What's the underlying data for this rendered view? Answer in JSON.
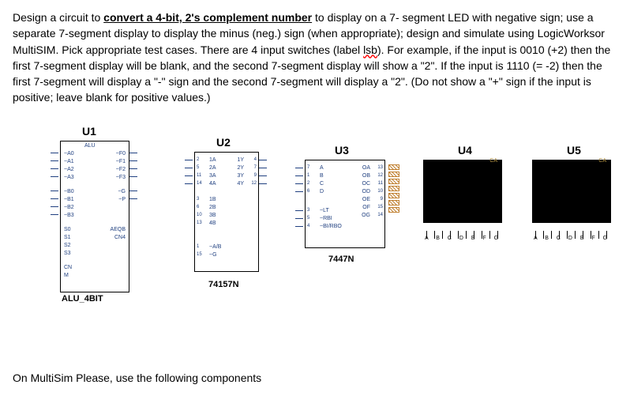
{
  "problem": {
    "lead_in": "Design a circuit to ",
    "underlined": "convert a 4-bit, 2's complement number",
    "rest1": " to display on a 7- segment LED with negative sign; use a separate 7-segment display to display the minus (neg.) sign (when appropriate); design and simulate using LogicWorksor MultiSIM. Pick appropriate test cases. There are 4 input switches (label ",
    "lsb": "lsb",
    "rest2": "). For example, if the input is 0010 (+2) then the first 7-segment display will be blank, and the second 7-segment display will show a \"2\". If the input is 1110 (= -2) then the first 7-segment will display a \"-\" sign and the second 7-segment will display a \"2\". (Do not show a \"+\" sign if the input is positive; leave blank for positive values.)"
  },
  "u1": {
    "ref": "U1",
    "block": "ALU",
    "name": "ALU_4BIT",
    "left_pins": [
      "~A0",
      "~A1",
      "~A2",
      "~A3",
      "~B0",
      "~B1",
      "~B2",
      "~B3",
      "S0",
      "S1",
      "S2",
      "S3",
      "CN",
      "M"
    ],
    "right_pins": [
      "~F0",
      "~F1",
      "~F2",
      "~F3",
      "~G",
      "~P",
      "AEQB",
      "CN4"
    ]
  },
  "u2": {
    "ref": "U2",
    "name": "74157N",
    "left_a": [
      "1A",
      "2A",
      "3A",
      "4A"
    ],
    "left_a_nums": [
      "2",
      "5",
      "11",
      "14"
    ],
    "left_b": [
      "1B",
      "2B",
      "3B",
      "4B"
    ],
    "left_b_nums": [
      "3",
      "6",
      "10",
      "13"
    ],
    "left_ctrl": [
      "~A/B",
      "~G"
    ],
    "left_ctrl_nums": [
      "1",
      "15"
    ],
    "right_y": [
      "1Y",
      "2Y",
      "3Y",
      "4Y"
    ],
    "right_y_nums": [
      "4",
      "7",
      "9",
      "12"
    ]
  },
  "u3": {
    "ref": "U3",
    "name": "7447N",
    "left": [
      "A",
      "B",
      "C",
      "D",
      "~LT",
      "~RBI",
      "~BI/RBO"
    ],
    "left_nums": [
      "7",
      "1",
      "2",
      "6",
      "3",
      "5",
      "4"
    ],
    "right": [
      "OA",
      "OB",
      "OC",
      "OD",
      "OE",
      "OF",
      "OG"
    ],
    "right_nums": [
      "13",
      "12",
      "11",
      "10",
      "9",
      "15",
      "14"
    ]
  },
  "u4": {
    "ref": "U4",
    "ca": "CA",
    "pins": "A B C D E F G"
  },
  "u5": {
    "ref": "U5",
    "ca": "CA",
    "pins": "A B C D E F G"
  },
  "footer": "On MultiSim Please, use the following components"
}
